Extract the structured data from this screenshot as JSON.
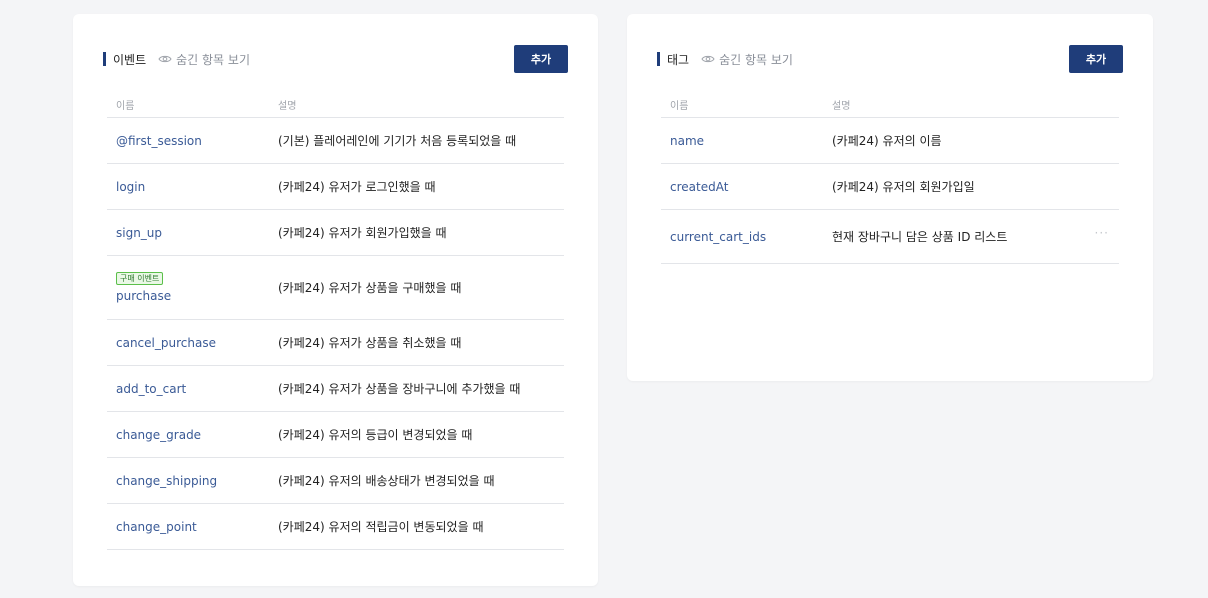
{
  "events": {
    "title": "이벤트",
    "show_hidden_label": "숨긴 항목 보기",
    "add_label": "추가",
    "columns": {
      "name": "이름",
      "desc": "설명"
    },
    "rows": [
      {
        "name": "@first_session",
        "desc": "(기본) 플레어레인에 기기가 처음 등록되었을 때"
      },
      {
        "name": "login",
        "desc": "(카페24) 유저가 로그인했을 때"
      },
      {
        "name": "sign_up",
        "desc": "(카페24) 유저가 회원가입했을 때"
      },
      {
        "name": "purchase",
        "badge": "구매 이벤트",
        "desc": "(카페24) 유저가 상품을 구매했을 때"
      },
      {
        "name": "cancel_purchase",
        "desc": "(카페24) 유저가 상품을 취소했을 때"
      },
      {
        "name": "add_to_cart",
        "desc": "(카페24) 유저가 상품을 장바구니에 추가했을 때"
      },
      {
        "name": "change_grade",
        "desc": "(카페24) 유저의 등급이 변경되었을 때"
      },
      {
        "name": "change_shipping",
        "desc": "(카페24) 유저의 배송상태가 변경되었을 때"
      },
      {
        "name": "change_point",
        "desc": "(카페24) 유저의 적립금이 변동되었을 때"
      }
    ]
  },
  "tags": {
    "title": "태그",
    "show_hidden_label": "숨긴 항목 보기",
    "add_label": "추가",
    "columns": {
      "name": "이름",
      "desc": "설명"
    },
    "rows": [
      {
        "name": "name",
        "desc": "(카페24) 유저의 이름"
      },
      {
        "name": "createdAt",
        "desc": "(카페24) 유저의 회원가입일"
      },
      {
        "name": "current_cart_ids",
        "desc": "현재 장바구니 담은 상품 ID 리스트",
        "more": "···"
      }
    ]
  },
  "colors": {
    "accent": "#1f3d7a",
    "link": "#3a5a96",
    "badge_border": "#5bbf4a"
  },
  "icons": {
    "show_hidden": "eye-icon",
    "row_menu": "more-horizontal-icon"
  }
}
